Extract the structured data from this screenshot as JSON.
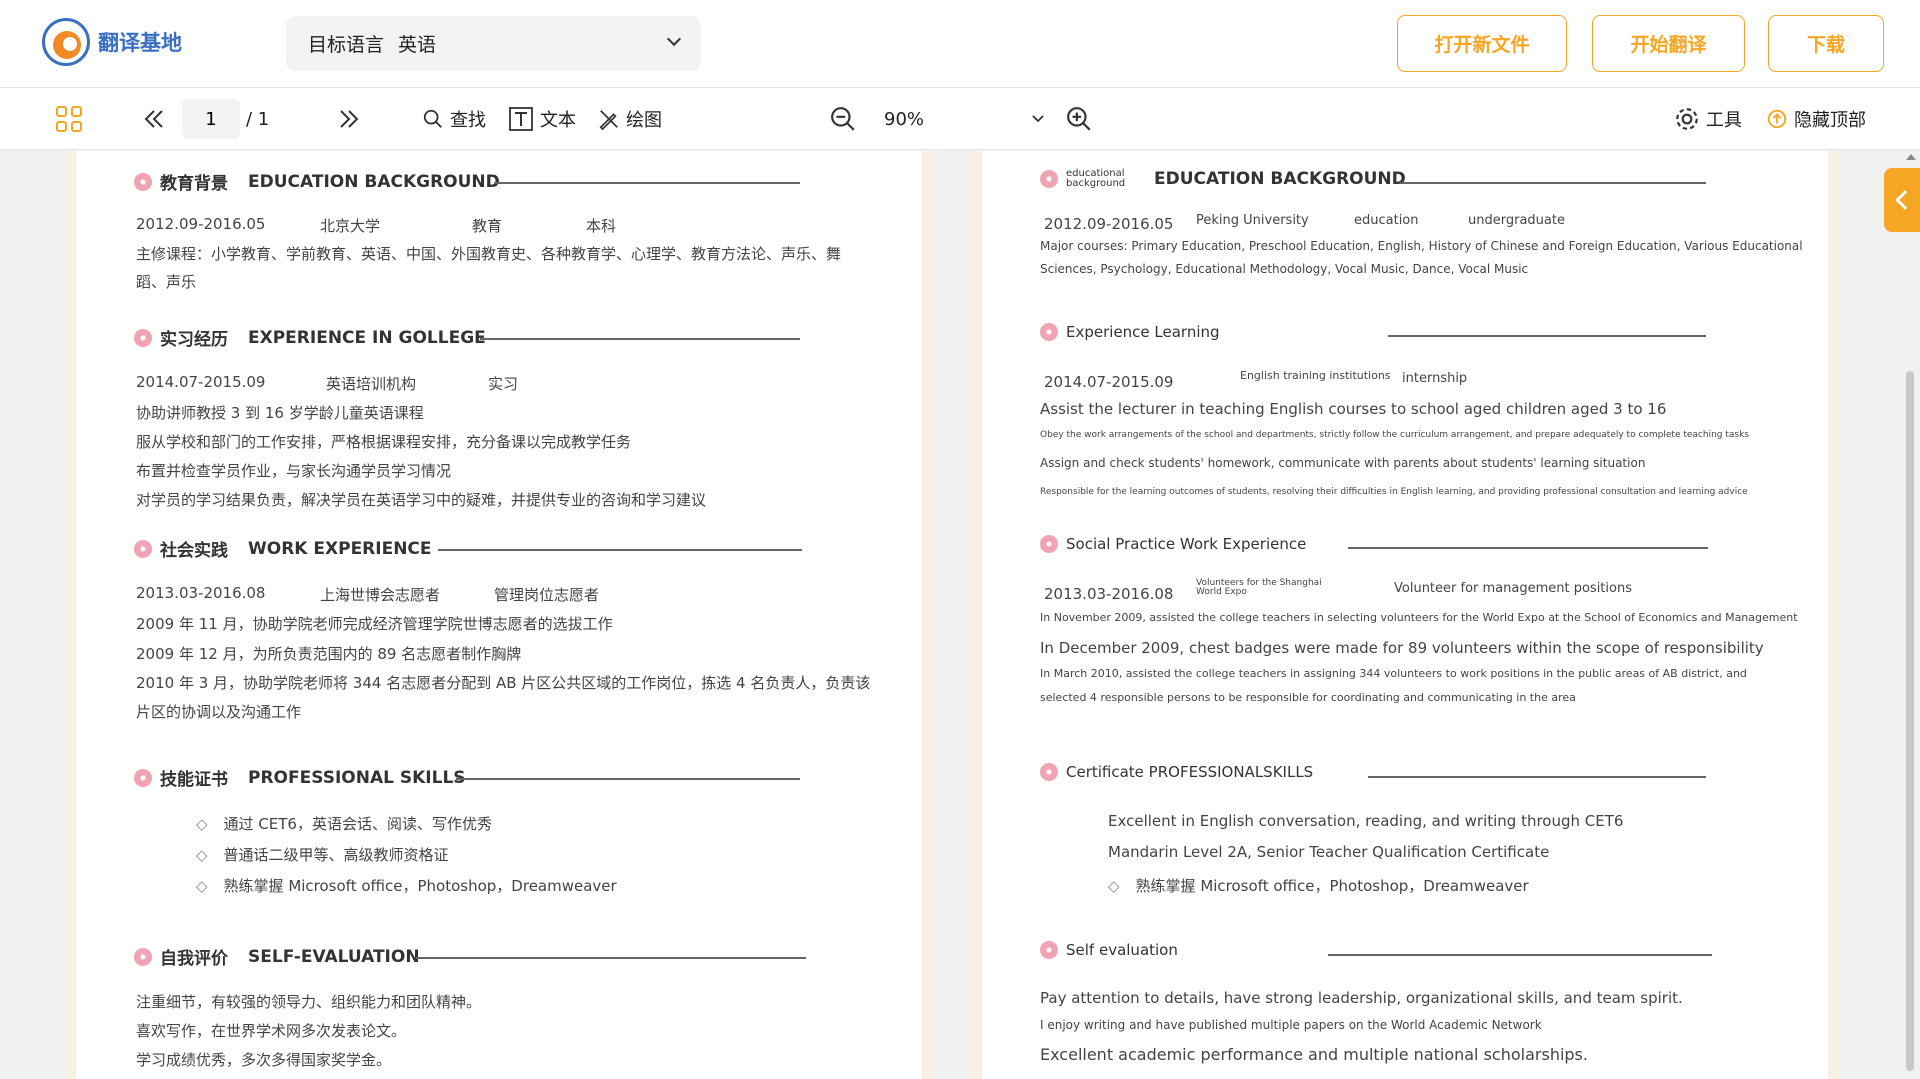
{
  "header": {
    "logo_text": "翻译基地",
    "lang_label": "目标语言",
    "lang_value": "英语",
    "open_label": "打开新文件",
    "translate_label": "开始翻译",
    "download_label": "下载"
  },
  "toolbar": {
    "page_current": "1",
    "page_total": "/ 1",
    "find_label": "查找",
    "text_label": "文本",
    "draw_label": "绘图",
    "zoom": "90%",
    "tools_label": "工具",
    "hide_top_label": "隐藏顶部"
  },
  "left": {
    "edu_cn": "教育背景",
    "edu_en": "EDUCATION BACKGROUND",
    "edu_date": "2012.09-2016.05",
    "edu_school": "北京大学",
    "edu_field": "教育",
    "edu_degree": "本科",
    "edu_courses_1": "主修课程：小学教育、学前教育、英语、中国、外国教育史、各种教育学、心理学、教育方法论、声乐、舞",
    "edu_courses_2": "蹈、声乐",
    "exp_cn": "实习经历",
    "exp_en": "EXPERIENCE IN GOLLEGE",
    "exp_date": "2014.07-2015.09",
    "exp_org": "英语培训机构",
    "exp_role": "实习",
    "exp_l1": "协助讲师教授 3 到 16 岁学龄儿童英语课程",
    "exp_l2": "服从学校和部门的工作安排，严格根据课程安排，充分备课以完成教学任务",
    "exp_l3": "布置并检查学员作业，与家长沟通学员学习情况",
    "exp_l4": "对学员的学习结果负责，解决学员在英语学习中的疑难，并提供专业的咨询和学习建议",
    "work_cn": "社会实践",
    "work_en": "WORK EXPERIENCE",
    "work_date": "2013.03-2016.08",
    "work_org": "上海世博会志愿者",
    "work_role": "管理岗位志愿者",
    "work_l1": "2009 年 11 月，协助学院老师完成经济管理学院世博志愿者的选拔工作",
    "work_l2": "2009 年 12 月，为所负责范围内的 89 名志愿者制作胸牌",
    "work_l3": "2010 年 3 月，协助学院老师将 344 名志愿者分配到 AB 片区公共区域的工作岗位，拣选 4 名负责人，负责该",
    "work_l4": "片区的协调以及沟通工作",
    "skill_cn": "技能证书",
    "skill_en": "PROFESSIONAL SKILLS",
    "skill_1": "通过 CET6，英语会话、阅读、写作优秀",
    "skill_2": "普通话二级甲等、高级教师资格证",
    "skill_3": "熟练掌握 Microsoft office，Photoshop，Dreamweaver",
    "self_cn": "自我评价",
    "self_en": "SELF-EVALUATION",
    "self_1": "注重细节，有较强的领导力、组织能力和团队精神。",
    "self_2": "喜欢写作，在世界学术网多次发表论文。",
    "self_3": "学习成绩优秀，多次多得国家奖学金。"
  },
  "right": {
    "edu_small": "educational background",
    "edu_en": "EDUCATION BACKGROUND",
    "edu_date": "2012.09-2016.05",
    "edu_school": "Peking University",
    "edu_field": "education",
    "edu_degree": "undergraduate",
    "edu_courses_1": "Major courses: Primary Education, Preschool Education, English, History of Chinese and Foreign Education, Various Educational",
    "edu_courses_2": "Sciences, Psychology, Educational Methodology, Vocal Music, Dance, Vocal Music",
    "exp_title": "Experience Learning",
    "exp_date": "2014.07-2015.09",
    "exp_org": "English training institutions",
    "exp_role": "internship",
    "exp_l1": "Assist the lecturer in teaching English courses to school aged children aged 3 to 16",
    "exp_l2": "Obey the work arrangements of the school and departments, strictly follow the curriculum arrangement, and prepare adequately to complete teaching tasks",
    "exp_l3": "Assign and check students' homework, communicate with parents about students' learning situation",
    "exp_l4": "Responsible for the learning outcomes of students, resolving their difficulties in English learning, and providing professional consultation and learning advice",
    "work_title": "Social Practice Work Experience",
    "work_date": "2013.03-2016.08",
    "work_org": "Volunteers for the Shanghai World Expo",
    "work_role": "Volunteer for management positions",
    "work_l1": "In November 2009, assisted the college teachers in selecting volunteers for the World Expo at the School of Economics and Management",
    "work_l2": "In December 2009, chest badges were made for 89 volunteers within the scope of responsibility",
    "work_l3": "In March 2010, assisted the college teachers in assigning 344 volunteers to work positions in the public areas of AB district, and",
    "work_l4": "selected 4 responsible persons to be responsible for coordinating and communicating in the area",
    "skill_title": "Certificate PROFESSIONALSKILLS",
    "skill_1": "Excellent in English conversation, reading, and writing through CET6",
    "skill_2": "Mandarin Level 2A, Senior Teacher Qualification Certificate",
    "skill_3": "熟练掌握 Microsoft office，Photoshop，Dreamweaver",
    "self_title": "Self evaluation",
    "self_1": "Pay attention to details, have strong leadership, organizational skills, and team spirit.",
    "self_2": "I enjoy writing and have published multiple papers on the World Academic Network",
    "self_3": "Excellent academic performance and multiple national scholarships."
  },
  "icons": {
    "accent": "#f5a623",
    "brand": "#3a6fc2"
  }
}
